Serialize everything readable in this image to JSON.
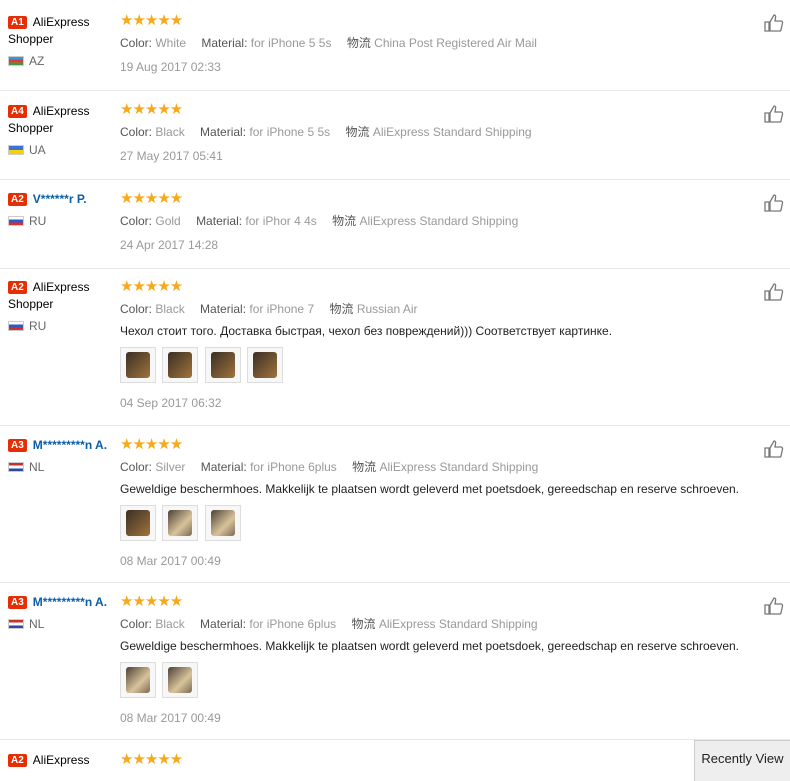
{
  "reviews": [
    {
      "badge": "A1",
      "name": "AliExpress Shopper",
      "country": "AZ",
      "stars": "★★★★★",
      "color_label": "Color:",
      "color": "White",
      "material_label": "Material:",
      "material": "for iPhone 5 5s",
      "ship_label": "物流",
      "shipping": "China Post Registered Air Mail",
      "date": "19 Aug 2017 02:33"
    },
    {
      "badge": "A4",
      "name": "AliExpress Shopper",
      "country": "UA",
      "stars": "★★★★★",
      "color_label": "Color:",
      "color": "Black",
      "material_label": "Material:",
      "material": "for iPhone 5 5s",
      "ship_label": "物流",
      "shipping": "AliExpress Standard Shipping",
      "date": "27 May 2017 05:41"
    },
    {
      "badge": "A2",
      "name": "V******r P.",
      "country": "RU",
      "stars": "★★★★★",
      "color_label": "Color:",
      "color": "Gold",
      "material_label": "Material:",
      "material": "for iPhor 4 4s",
      "ship_label": "物流",
      "shipping": "AliExpress Standard Shipping",
      "date": "24 Apr 2017 14:28"
    },
    {
      "badge": "A2",
      "name": "AliExpress Shopper",
      "country": "RU",
      "stars": "★★★★★",
      "color_label": "Color:",
      "color": "Black",
      "material_label": "Material:",
      "material": "for iPhone 7",
      "ship_label": "物流",
      "shipping": "Russian Air",
      "text": "Чехол стоит того. Доставка быстрая, чехол без повреждений))) Соответствует картинке.",
      "date": "04 Sep 2017 06:32"
    },
    {
      "badge": "A3",
      "name": "M*********n A.",
      "country": "NL",
      "stars": "★★★★★",
      "color_label": "Color:",
      "color": "Silver",
      "material_label": "Material:",
      "material": "for iPhone 6plus",
      "ship_label": "物流",
      "shipping": "AliExpress Standard Shipping",
      "text": "Geweldige beschermhoes. Makkelijk te plaatsen wordt geleverd met poetsdoek, gereedschap en reserve schroeven.",
      "date": "08 Mar 2017 00:49"
    },
    {
      "badge": "A3",
      "name": "M*********n A.",
      "country": "NL",
      "stars": "★★★★★",
      "color_label": "Color:",
      "color": "Black",
      "material_label": "Material:",
      "material": "for iPhone 6plus",
      "ship_label": "物流",
      "shipping": "AliExpress Standard Shipping",
      "text": "Geweldige beschermhoes. Makkelijk te plaatsen wordt geleverd met poetsdoek, gereedschap en reserve schroeven.",
      "date": "08 Mar 2017 00:49"
    },
    {
      "badge": "A2",
      "name": "AliExpress",
      "stars": "★★★★★"
    }
  ],
  "icons": {
    "like": "thumbs-up-icon"
  },
  "colors": {
    "badge": "#e62e04",
    "stars": "#f7a81b",
    "masked_name": "#0a5ea8"
  },
  "recently_viewed_label": "Recently View"
}
